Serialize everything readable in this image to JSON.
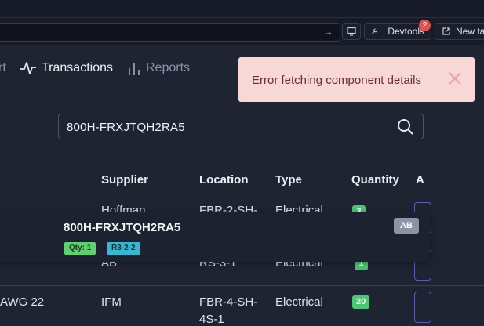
{
  "browser": {
    "devtools_label": "Devtools",
    "devtools_badge": "2",
    "new_tab_label": "New ta"
  },
  "nav": {
    "partial_left": "rt",
    "transactions": "Transactions",
    "reports": "Reports"
  },
  "toast": {
    "message": "Error fetching component details"
  },
  "search": {
    "value": "800H-FRXJTQH2RA5"
  },
  "table": {
    "headers": [
      "Supplier",
      "Location",
      "Type",
      "Quantity",
      "A"
    ],
    "row1": {
      "supplier": "Hoffman",
      "location": "FBR-2-SH-",
      "type": "Electrical",
      "qty": "3"
    },
    "row2": {
      "supplier": "AB",
      "location": "RS-3-1",
      "type": "Electrical",
      "qty": "1"
    },
    "row3": {
      "part": "AWG 22",
      "supplier": "IFM",
      "location": "FBR-4-SH-",
      "location2": "4S-1",
      "type": "Electrical",
      "qty": "20"
    }
  },
  "dropdown": {
    "title": "800H-FRXJTQH2RA5",
    "qty_tag": "Qty: 1",
    "location_tag": "R3-2-2",
    "avatar": "AB"
  }
}
